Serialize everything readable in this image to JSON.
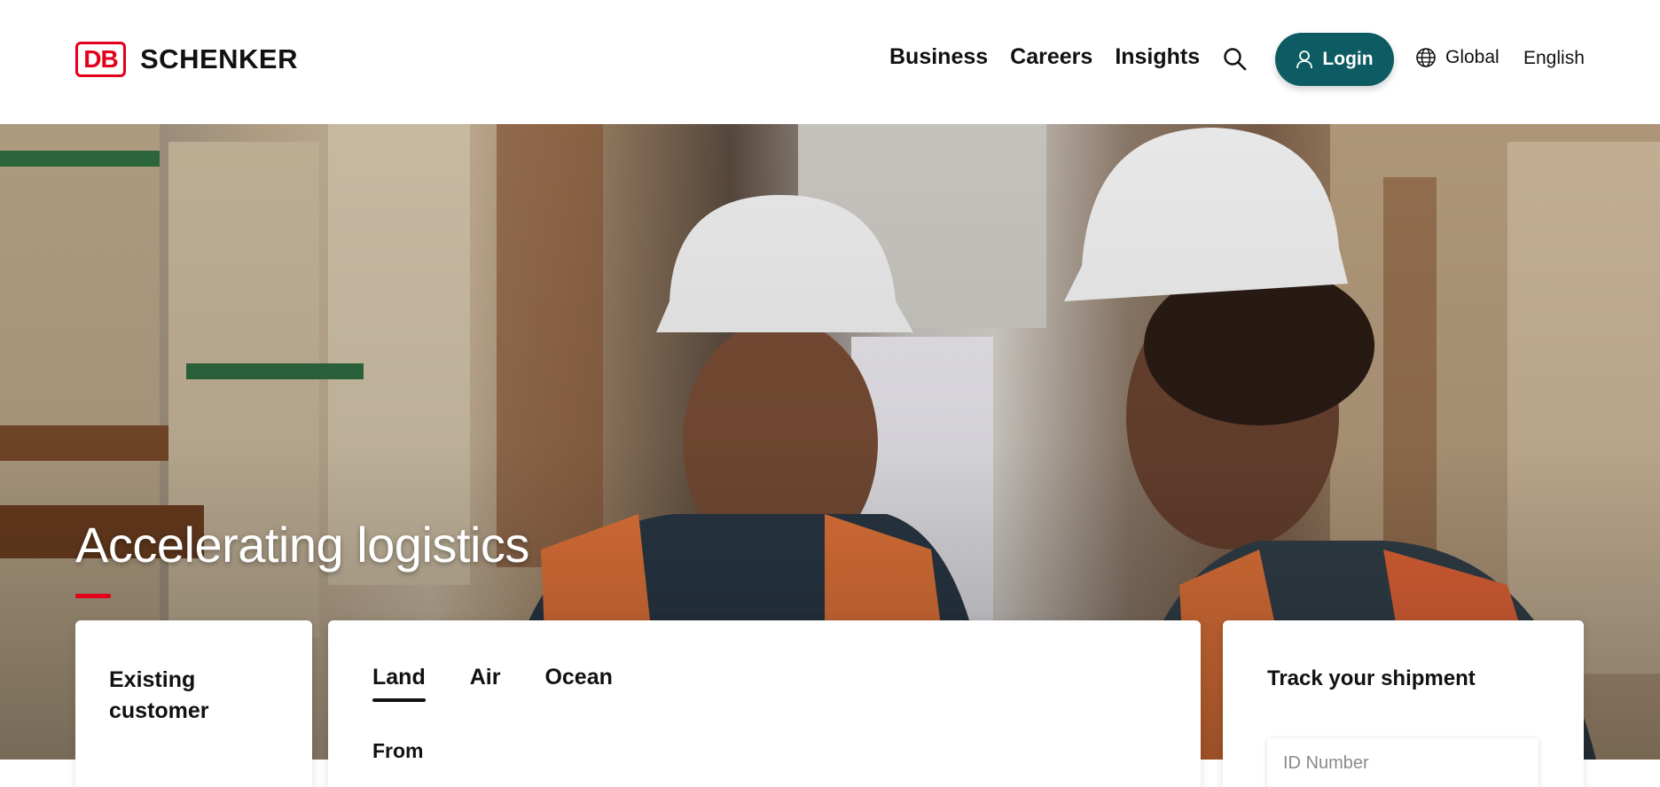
{
  "brand": {
    "mark": "DB",
    "name": "SCHENKER",
    "accent": "#e2001a"
  },
  "nav": {
    "items": [
      {
        "label": "Business"
      },
      {
        "label": "Careers"
      },
      {
        "label": "Insights"
      }
    ]
  },
  "header": {
    "search_icon": "search-icon",
    "login": {
      "label": "Login",
      "icon": "user-icon",
      "color": "#0d5c63"
    },
    "region": {
      "label": "Global",
      "icon": "globe-icon"
    },
    "language": "English"
  },
  "hero": {
    "title": "Accelerating logistics"
  },
  "existing_customer": {
    "title": "Existing customer"
  },
  "quote": {
    "tabs": [
      {
        "label": "Land",
        "active": true
      },
      {
        "label": "Air"
      },
      {
        "label": "Ocean"
      }
    ],
    "from_label": "From"
  },
  "track": {
    "title": "Track your shipment",
    "placeholder": "ID Number",
    "value": ""
  }
}
